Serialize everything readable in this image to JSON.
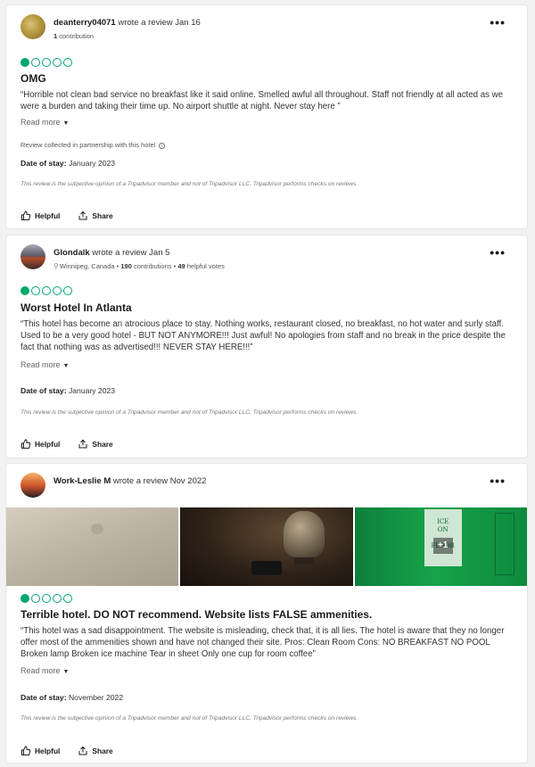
{
  "reviews": [
    {
      "username": "deanterry04071",
      "wrote": "wrote a review Jan 16",
      "contrib_count": "1",
      "contrib_text": "contribution",
      "location": "",
      "votes": "",
      "rating": 1,
      "title": "OMG",
      "body": "“Horrible not clean bad service no breakfast like it said online. Smelled awful all throughout. Staff not friendly at all acted as we were a burden and taking their time up. No airport shuttle at night. Never stay here ”",
      "read_more": "Read more",
      "collected": "Review collected in partnership with this hotel",
      "date_label": "Date of stay:",
      "date_value": "January 2023",
      "disclaimer": "This review is the subjective opinion of a Tripadvisor member and not of Tripadvisor LLC. Tripadvisor performs checks on reviews.",
      "helpful": "Helpful",
      "share": "Share"
    },
    {
      "username": "Glondalk",
      "wrote": "wrote a review Jan 5",
      "location": "Winnipeg, Canada",
      "contrib_count": "190",
      "contrib_text": "contributions",
      "votes_count": "49",
      "votes_text": "helpful votes",
      "rating": 1,
      "title": "Worst Hotel In Atlanta",
      "body": "“This hotel has become an atrocious place to stay. Nothing works, restaurant closed, no breakfast, no hot water and surly staff. Used to be a very good hotel - BUT NOT ANYMORE!!! Just awful! No apologies from staff and no break in the price despite the fact that nothing was as advertised!!! NEVER STAY HERE!!!”",
      "read_more": "Read more",
      "date_label": "Date of stay:",
      "date_value": "January 2023",
      "disclaimer": "This review is the subjective opinion of a Tripadvisor member and not of Tripadvisor LLC. Tripadvisor performs checks on reviews.",
      "helpful": "Helpful",
      "share": "Share"
    },
    {
      "username": "Work-Leslie M",
      "wrote": "wrote a review Nov 2022",
      "rating": 1,
      "photo_more": "+1",
      "sign_text": [
        "ICE",
        "ON",
        "FLOOR"
      ],
      "title": "Terrible hotel. DO NOT recommend. Website lists FALSE ammenities.",
      "body": "“This hotel was a sad disappointment. The website is misleading, check that, it is all lies. The hotel is aware that they no longer offer most of the ammenities shown and have not changed their site. Pros: Clean Room Cons: NO BREAKFAST NO POOL Broken lamp Broken ice machine Tear in sheet Only one cup for room coffee”",
      "read_more": "Read more",
      "date_label": "Date of stay:",
      "date_value": "November 2022",
      "disclaimer": "This review is the subjective opinion of a Tripadvisor member and not of Tripadvisor LLC. Tripadvisor performs checks on reviews.",
      "helpful": "Helpful",
      "share": "Share"
    }
  ],
  "icons": {
    "more": "more-options-icon",
    "helpful": "thumbs-up-icon",
    "share": "share-icon",
    "location": "location-pin-icon",
    "info": "info-icon"
  },
  "colors": {
    "rating_green": "#00aa6c",
    "background": "#f2f2f2"
  }
}
